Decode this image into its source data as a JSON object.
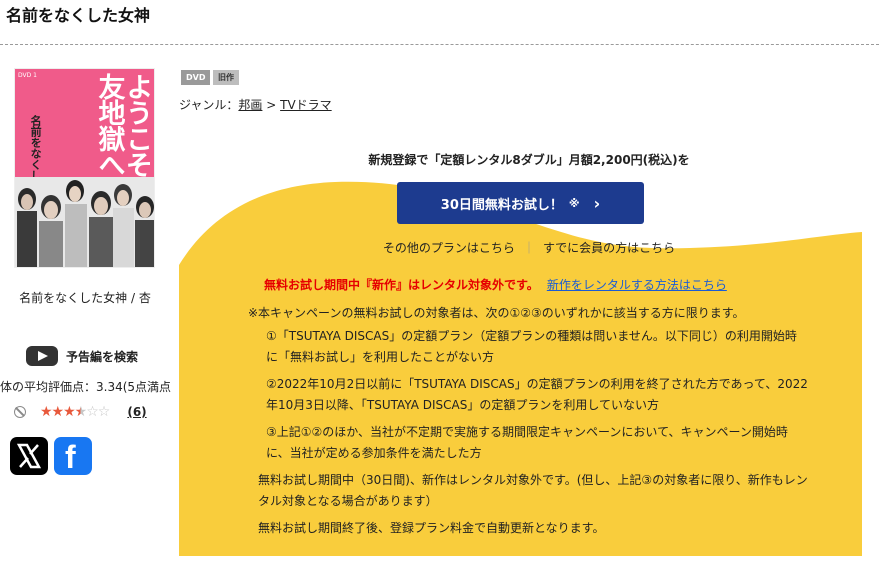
{
  "page": {
    "title": "名前をなくした女神"
  },
  "cover": {
    "headline": "ようこそ、ママ友地獄へ。",
    "subtitle": "名前をなくした女神",
    "volume_mark": "DVD 1"
  },
  "work": {
    "caption": "名前をなくした女神 / 杏"
  },
  "trailer": {
    "label": "予告編を検索"
  },
  "rating": {
    "summary": "体の平均評価点：3.34(5点満点",
    "stars_display": {
      "full": "★★★",
      "half": "★",
      "empty": "☆☆"
    },
    "value": 3.34,
    "max": 5,
    "review_count": "(6)"
  },
  "share": {
    "x_icon": "x-logo-icon",
    "facebook_icon": "facebook-logo-icon",
    "facebook_glyph": "f"
  },
  "badges": {
    "format": "DVD",
    "age": "旧作"
  },
  "genre": {
    "prefix": "ジャンル：",
    "level1": "邦画",
    "separator": " > ",
    "level2": "TVドラマ"
  },
  "campaign": {
    "lead": "新規登録で「定額レンタル8ダブル」月額2,200円(税込)を",
    "trial_button": "30日間無料お試し！",
    "trial_note": "※",
    "trial_chevron": "›",
    "other_plans": "その他のプランはこちら",
    "separator": "｜",
    "member_login": "すでに会員の方はこちら",
    "warning": "無料お試し期間中『新作』はレンタル対象外です。",
    "warning_link": "新作をレンタルする方法はこちら",
    "notes_lead": "※本キャンペーンの無料お試しの対象者は、次の①②③のいずれかに該当する方に限ります。",
    "condition_1": "①「TSUTAYA DISCAS」の定額プラン（定額プランの種類は問いません。以下同じ）の利用開始時に「無料お試し」を利用したことがない方",
    "condition_2": "②2022年10月2日以前に「TSUTAYA DISCAS」の定額プランの利用を終了された方であって、2022年10月3日以降、「TSUTAYA DISCAS」の定額プランを利用していない方",
    "condition_3": "③上記①②のほか、当社が不定期で実施する期間限定キャンペーンにおいて、キャンペーン開始時に、当社が定める参加条件を満たした方",
    "note_trial_period": "無料お試し期間中（30日間)、新作はレンタル対象外です。(但し、上記③の対象者に限り、新作もレンタル対象となる場合があります）",
    "note_renewal": "無料お試し期間終了後、登録プラン料金で自動更新となります。"
  },
  "colors": {
    "campaign_yellow": "#f9cd3c",
    "button_navy": "#1d3b8f",
    "cover_pink": "#f05b8a",
    "warning_red": "#e60000",
    "link_blue": "#1a5cd6",
    "star_orange": "#e8593c"
  }
}
